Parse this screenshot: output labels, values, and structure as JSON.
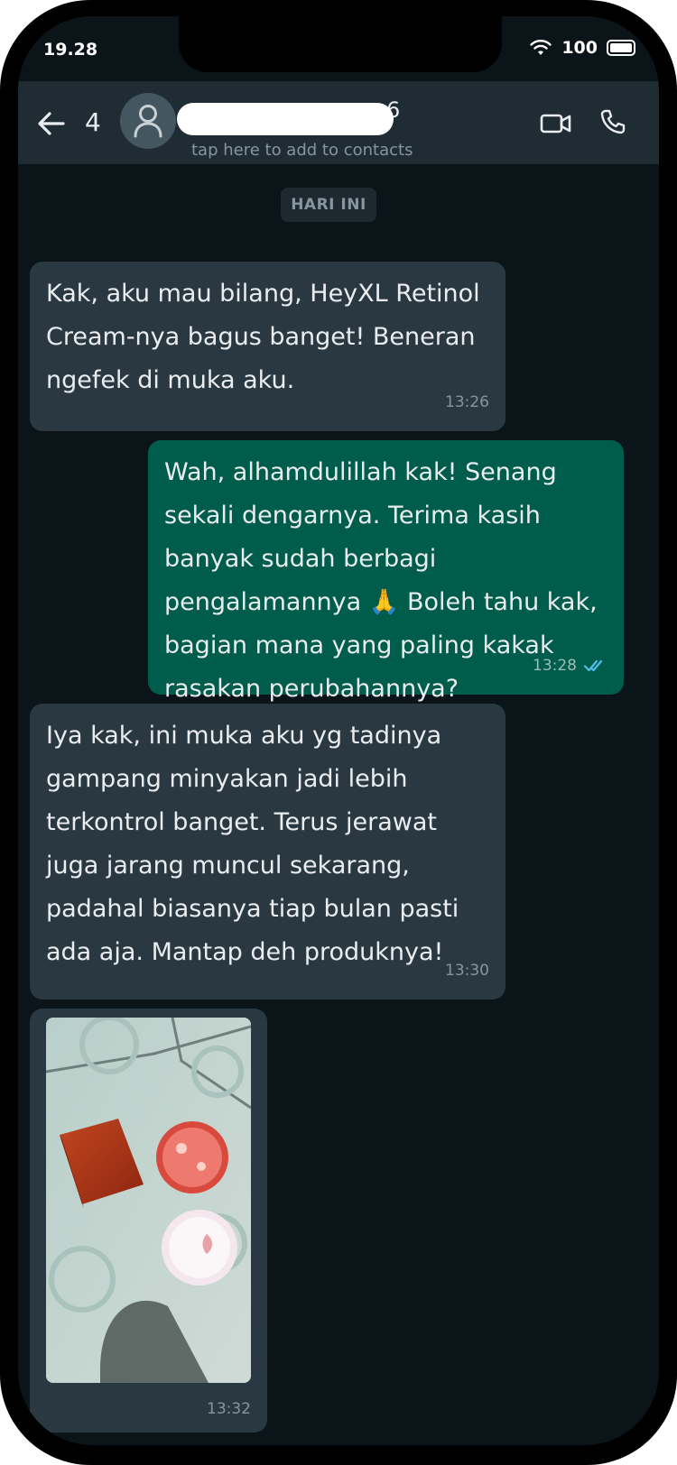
{
  "status_bar": {
    "time": "19.28",
    "battery": "100"
  },
  "header": {
    "unread_count": "4",
    "name_visible_suffix": "6",
    "subtitle": "tap here to add to contacts"
  },
  "chat": {
    "date_label": "HARI INI",
    "messages": [
      {
        "direction": "incoming",
        "text": "Kak, aku mau bilang, HeyXL Retinol Cream-nya bagus banget! Beneran ngefek di muka aku.",
        "time": "13:26"
      },
      {
        "direction": "outgoing",
        "text": "Wah, alhamdulillah kak! Senang sekali dengarnya. Terima kasih banyak sudah berbagi pengalamannya 🙏 Boleh tahu kak, bagian mana yang paling kakak rasakan perubahannya?",
        "time": "13:28",
        "status": "read"
      },
      {
        "direction": "incoming",
        "text": "Iya kak, ini muka aku yg tadinya gampang minyakan jadi lebih terkontrol banget. Terus jerawat juga jarang muncul sekarang, padahal biasanya tiap bulan pasti ada aja. Mantap deh produknya!",
        "time": "13:30"
      },
      {
        "direction": "incoming",
        "type": "image",
        "time": "13:32"
      }
    ]
  },
  "colors": {
    "header_bg": "#1f2c33",
    "chat_bg": "#0b1418",
    "incoming_bubble": "#2a3941",
    "outgoing_bubble": "#005c4b",
    "read_ticks": "#53bdeb"
  }
}
